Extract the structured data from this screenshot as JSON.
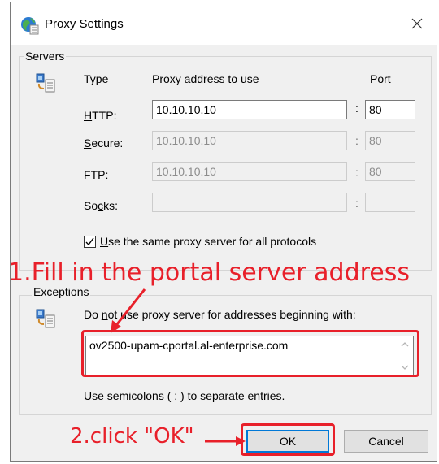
{
  "window": {
    "title": "Proxy Settings"
  },
  "servers": {
    "legend": "Servers",
    "col_type": "Type",
    "col_address": "Proxy address to use",
    "col_port": "Port",
    "rows": [
      {
        "key": "H",
        "rest": "TTP:",
        "address": "10.10.10.10",
        "port": "80",
        "enabled": true
      },
      {
        "key": "S",
        "rest": "ecure:",
        "address": "10.10.10.10",
        "port": "80",
        "enabled": false
      },
      {
        "key": "F",
        "rest": "TP:",
        "address": "10.10.10.10",
        "port": "80",
        "enabled": false
      },
      {
        "prefix": "So",
        "key": "c",
        "rest": "ks:",
        "address": "",
        "port": "",
        "enabled": false
      }
    ],
    "colon": ":",
    "same_proxy_key": "U",
    "same_proxy_rest": "se the same proxy server for all protocols",
    "same_proxy_checked": true
  },
  "exceptions": {
    "legend": "Exceptions",
    "desc_prefix": "Do ",
    "desc_key": "n",
    "desc_rest": "ot use proxy server for addresses beginning with:",
    "value": "ov2500-upam-cportal.al-enterprise.com",
    "hint": "Use semicolons ( ; ) to separate entries."
  },
  "buttons": {
    "ok": "OK",
    "cancel": "Cancel"
  },
  "annotations": {
    "step1": "1.Fill in the portal server address",
    "step2": "2.click \"OK\"",
    "color": "#e8202a"
  }
}
